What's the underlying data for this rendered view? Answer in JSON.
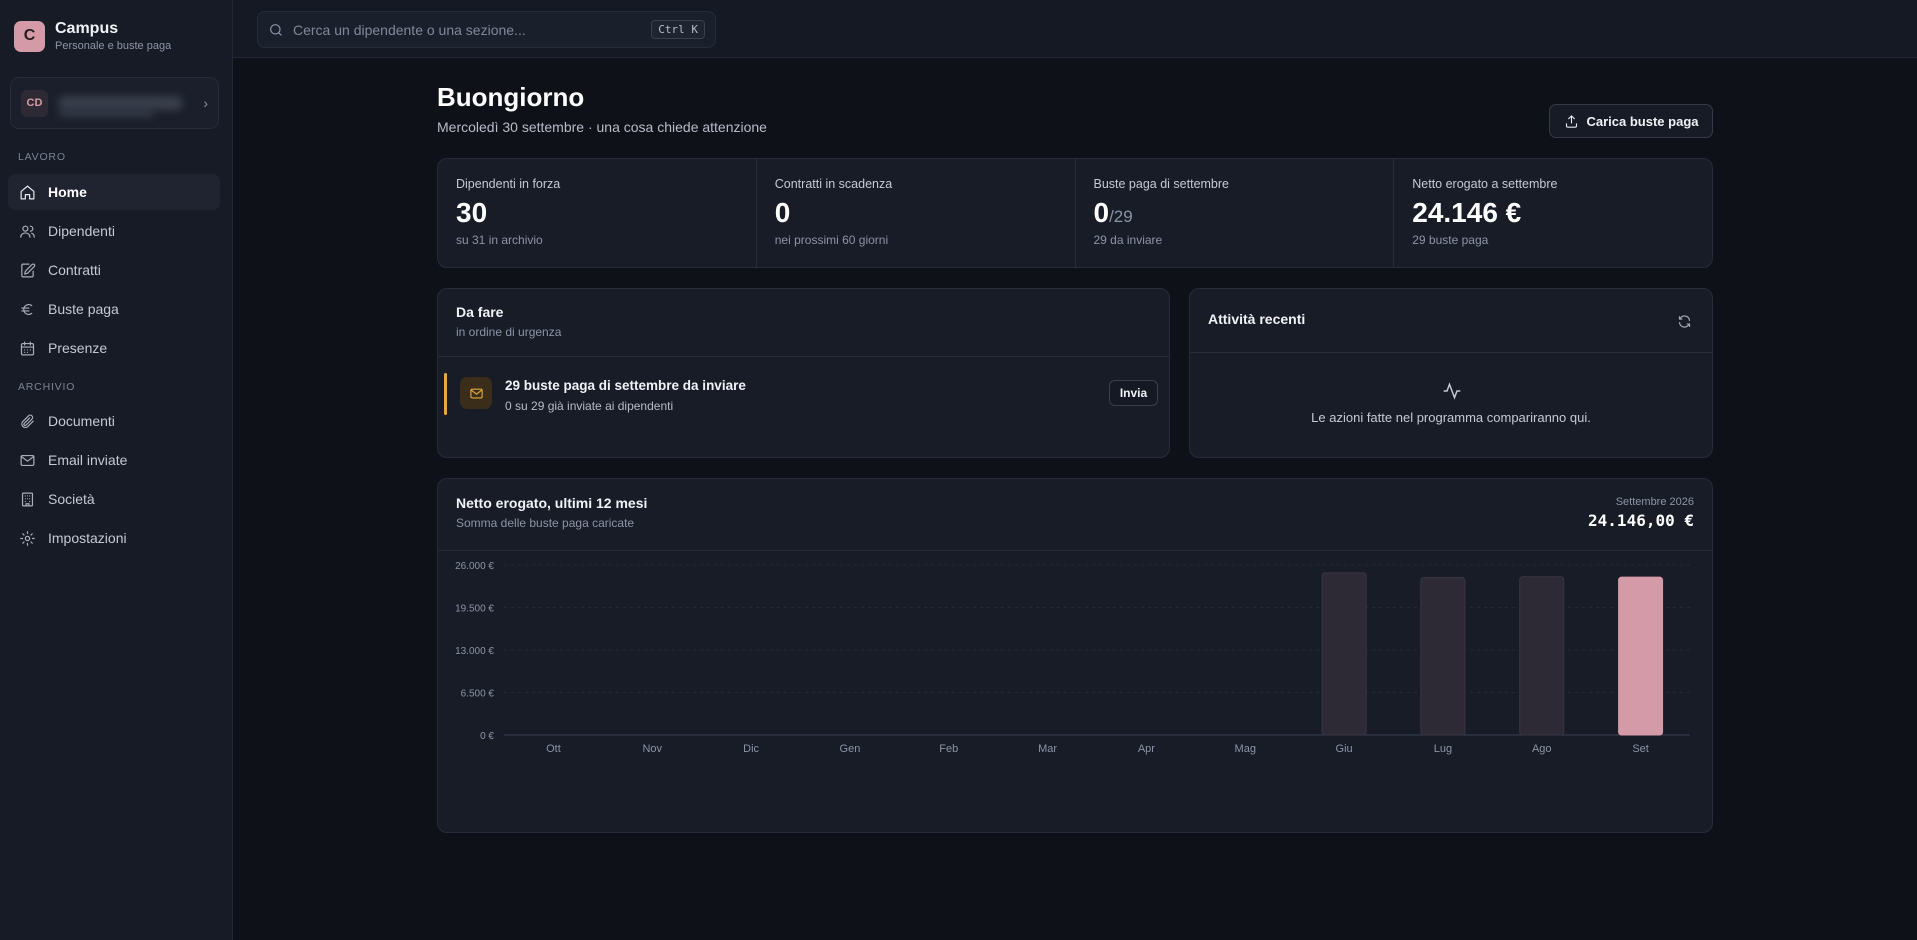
{
  "app": {
    "name": "Campus",
    "subtitle": "Personale e buste paga",
    "logo_letter": "C"
  },
  "user": {
    "initials": "CD"
  },
  "sidebar": {
    "sections": [
      "LAVORO",
      "ARCHIVIO"
    ],
    "items": [
      {
        "label": "Home",
        "icon": "home-icon",
        "active": true
      },
      {
        "label": "Dipendenti",
        "icon": "users-icon"
      },
      {
        "label": "Contratti",
        "icon": "contract-icon"
      },
      {
        "label": "Buste paga",
        "icon": "euro-icon"
      },
      {
        "label": "Presenze",
        "icon": "calendar-icon"
      },
      {
        "label": "Documenti",
        "icon": "paperclip-icon"
      },
      {
        "label": "Email inviate",
        "icon": "mail-icon"
      },
      {
        "label": "Società",
        "icon": "building-icon"
      },
      {
        "label": "Impostazioni",
        "icon": "gear-icon"
      }
    ]
  },
  "search": {
    "placeholder": "Cerca un dipendente o una sezione...",
    "shortcut": "Ctrl K"
  },
  "header": {
    "greeting": "Buongiorno",
    "subtitle": "Mercoledì 30 settembre · una cosa chiede attenzione",
    "upload_label": "Carica buste paga"
  },
  "stats": [
    {
      "label": "Dipendenti in forza",
      "value": "30",
      "sub": "su 31 in archivio"
    },
    {
      "label": "Contratti in scadenza",
      "value": "0",
      "sub": "nei prossimi 60 giorni"
    },
    {
      "label": "Buste paga di settembre",
      "value": "0",
      "denominator": "/29",
      "sub": "29 da inviare"
    },
    {
      "label": "Netto erogato a settembre",
      "value": "24.146 €",
      "sub": "29 buste paga"
    }
  ],
  "todo": {
    "title": "Da fare",
    "subtitle": "in ordine di urgenza",
    "items": [
      {
        "title": "29 buste paga di settembre da inviare",
        "sub": "0 su 29 già inviate ai dipendenti",
        "action": "Invia",
        "icon": "mail-icon",
        "color": "#e6a93a"
      }
    ]
  },
  "activity": {
    "title": "Attività recenti",
    "empty": "Le azioni fatte nel programma compariranno qui."
  },
  "chart": {
    "title": "Netto erogato, ultimi 12 mesi",
    "subtitle": "Somma delle buste paga caricate",
    "period": "Settembre 2026",
    "total": "24.146,00 €"
  },
  "chart_data": {
    "type": "bar",
    "categories": [
      "Ott",
      "Nov",
      "Dic",
      "Gen",
      "Feb",
      "Mar",
      "Apr",
      "Mag",
      "Giu",
      "Lug",
      "Ago",
      "Set"
    ],
    "values": [
      0,
      0,
      0,
      0,
      0,
      0,
      0,
      0,
      24800,
      24100,
      24200,
      24146
    ],
    "yticks": [
      "0 €",
      "6.500 €",
      "13.000 €",
      "19.500 €",
      "26.000 €"
    ],
    "ylim": [
      0,
      26000
    ],
    "bar_color": "#2d2a36",
    "highlight_color": "#d59aa8",
    "highlight_index": 11,
    "grid": true
  }
}
